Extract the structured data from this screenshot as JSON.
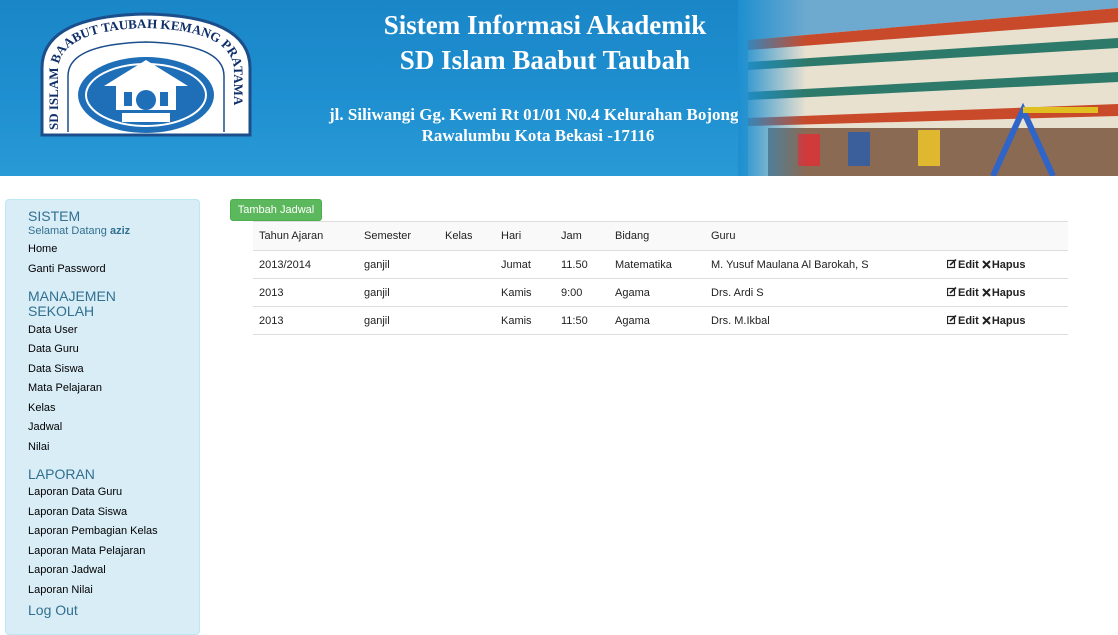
{
  "header": {
    "title_line1": "Sistem Informasi Akademik",
    "title_line2": "SD Islam Baabut Taubah",
    "address_line1": "jl. Siliwangi Gg. Kweni Rt 01/01 N0.4 Kelurahan Bojong .",
    "address_line2": "Rawalumbu Kota Bekasi -17116",
    "logo_ring_text": "SD ISLAM BAABUT TAUBAH KEMANG PRATAMA"
  },
  "sidebar": {
    "section_sistem": "SISTEM",
    "welcome_prefix": "Selamat Datang",
    "welcome_user": "aziz",
    "sistem_items": [
      "Home",
      "Ganti Password"
    ],
    "section_manajemen_line1": "MANAJEMEN",
    "section_manajemen_line2": "SEKOLAH",
    "manajemen_items": [
      "Data User",
      "Data Guru",
      "Data Siswa",
      "Mata Pelajaran",
      "Kelas",
      "Jadwal",
      "Nilai"
    ],
    "section_laporan": "LAPORAN",
    "laporan_items": [
      "Laporan Data Guru",
      "Laporan Data Siswa",
      "Laporan Pembagian Kelas",
      "Laporan Mata Pelajaran",
      "Laporan Jadwal",
      "Laporan Nilai"
    ],
    "logout": "Log Out"
  },
  "content": {
    "add_button": "Tambah Jadwal",
    "table": {
      "headers": [
        "Tahun Ajaran",
        "Semester",
        "Kelas",
        "Hari",
        "Jam",
        "Bidang",
        "Guru",
        ""
      ],
      "rows": [
        {
          "tahun": "2013/2014",
          "semester": "ganjil",
          "kelas": "",
          "hari": "Jumat",
          "jam": "11.50",
          "bidang": "Matematika",
          "guru": "M. Yusuf Maulana Al Barokah, S"
        },
        {
          "tahun": "2013",
          "semester": "ganjil",
          "kelas": "",
          "hari": "Kamis",
          "jam": "9:00",
          "bidang": "Agama",
          "guru": "Drs. Ardi S"
        },
        {
          "tahun": "2013",
          "semester": "ganjil",
          "kelas": "",
          "hari": "Kamis",
          "jam": "11:50",
          "bidang": "Agama",
          "guru": "Drs. M.Ikbal"
        }
      ],
      "edit_label": "Edit",
      "delete_label": "Hapus"
    }
  },
  "colors": {
    "banner_blue": "#1e8fd0",
    "sidebar_bg": "#d9edf7",
    "sidebar_heading": "#31708f",
    "button_green": "#5cb85c"
  }
}
